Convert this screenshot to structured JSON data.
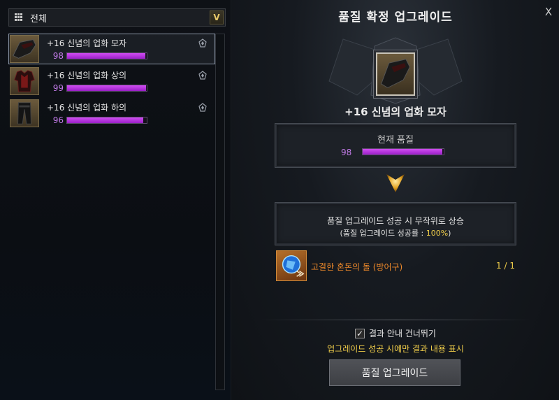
{
  "filter": {
    "label": "전체",
    "icon": "grid-icon",
    "chevron": "chevron-down-icon"
  },
  "items": [
    {
      "name": "+16 신념의 업화 모자",
      "quality": "98",
      "quality_fraction": 0.98,
      "type": "hat",
      "selected": true
    },
    {
      "name": "+16 신념의 업화 상의",
      "quality": "99",
      "quality_fraction": 0.99,
      "type": "top",
      "selected": false
    },
    {
      "name": "+16 신념의 업화 하의",
      "quality": "96",
      "quality_fraction": 0.96,
      "type": "pants",
      "selected": false
    }
  ],
  "dialog": {
    "title": "품질 확정 업그레이드",
    "close_label": "X",
    "item_name": "+16 신념의 업화 모자",
    "current_quality_label": "현재 품질",
    "current_quality": "98",
    "current_quality_fraction": 0.98,
    "upgrade_desc": "품질 업그레이드 성공 시 무작위로 상승",
    "upgrade_rate_prefix": "(품질 업그레이드 성공률 : ",
    "upgrade_rate": "100%",
    "upgrade_rate_suffix": ")",
    "material_name": "고결한 혼돈의 돌 (방어구)",
    "material_count": "1 / 1",
    "skip_label": "결과 안내 건너뛰기",
    "skip_checked": true,
    "skip_note": "업그레이드 성공 시에만 결과 내용 표시",
    "button_label": "품질 업그레이드"
  },
  "colors": {
    "quality_purple": "#c27be8",
    "bar_fill": "#b62fdc",
    "accent_gold": "#f2cf4a",
    "material_orange": "#f08a2a"
  }
}
